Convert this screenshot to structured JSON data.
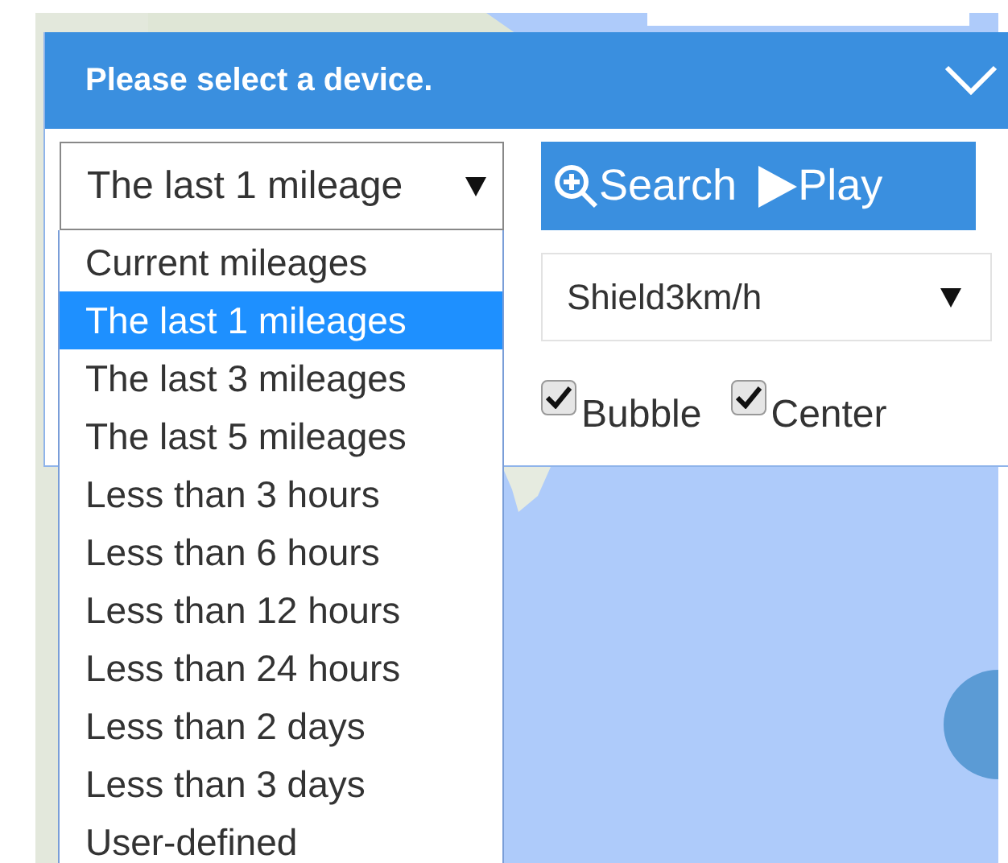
{
  "panel": {
    "title": "Please select a device."
  },
  "range_select": {
    "value": "The last 1 mileage",
    "options": [
      {
        "label": "Current mileages",
        "selected": false
      },
      {
        "label": "The last 1 mileages",
        "selected": true
      },
      {
        "label": "The last 3 mileages",
        "selected": false
      },
      {
        "label": "The last 5 mileages",
        "selected": false
      },
      {
        "label": "Less than 3 hours",
        "selected": false
      },
      {
        "label": "Less than 6 hours",
        "selected": false
      },
      {
        "label": "Less than 12 hours",
        "selected": false
      },
      {
        "label": "Less than 24 hours",
        "selected": false
      },
      {
        "label": "Less than 2 days",
        "selected": false
      },
      {
        "label": "Less than 3 days",
        "selected": false
      },
      {
        "label": "User-defined",
        "selected": false
      }
    ]
  },
  "buttons": [
    {
      "label": "Search",
      "kind": "search"
    },
    {
      "label": "Play",
      "kind": "play"
    }
  ],
  "speed_select": {
    "value": "Shield3km/h"
  },
  "options": [
    {
      "label": "Bubble",
      "checked": true
    },
    {
      "label": "Center",
      "checked": true
    }
  ]
}
